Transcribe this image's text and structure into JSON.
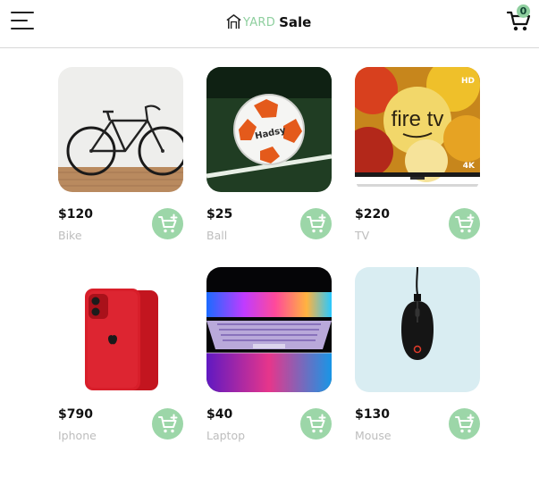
{
  "header": {
    "menu_icon": "hamburger-menu-icon",
    "brand_icon": "house-icon",
    "brand_prefix": "YARD",
    "brand_name": "Sale",
    "cart_icon": "shopping-cart-icon",
    "cart_count": "0"
  },
  "colors": {
    "accent": "#9cd6a8",
    "brand_prefix": "#8fcf9f",
    "muted_text": "#bdbdbd"
  },
  "products": [
    {
      "price": "$120",
      "name": "Bike",
      "image": "bicycle"
    },
    {
      "price": "$25",
      "name": "Ball",
      "image": "soccer-ball",
      "ball_brand": "Hadsy"
    },
    {
      "price": "$220",
      "name": "TV",
      "image": "fire-tv",
      "brand": "fire tv",
      "badge_hd": "HD",
      "badge_4k": "4K"
    },
    {
      "price": "$790",
      "name": "Iphone",
      "image": "red-iphone"
    },
    {
      "price": "$40",
      "name": "Laptop",
      "image": "laptop-keyboard"
    },
    {
      "price": "$130",
      "name": "Mouse",
      "image": "gaming-mouse"
    }
  ],
  "add_to_cart_icon": "add-to-cart-icon"
}
